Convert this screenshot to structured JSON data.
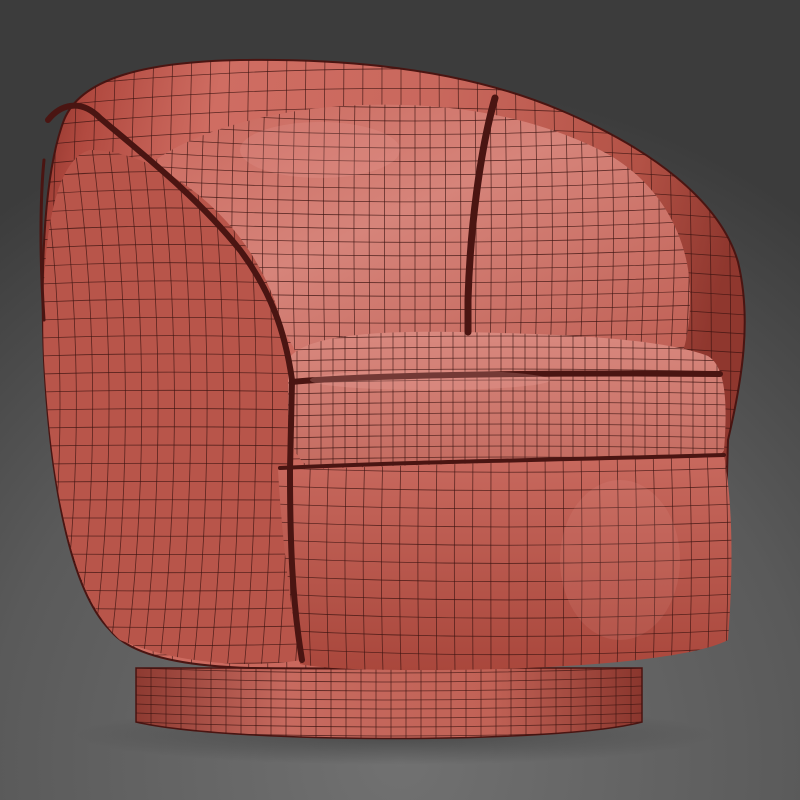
{
  "scene": {
    "subject": "chair",
    "render_mode": "shaded-wireframe",
    "colors": {
      "background_top": "#3b3b3b",
      "background_bottom": "#707070",
      "fabric_light": "#d0776c",
      "fabric_mid": "#b85a4f",
      "fabric_dark": "#7e3029",
      "fabric_shadow": "#5a1f1a",
      "wire": "#3a1310",
      "piping": "#4a1512"
    }
  }
}
